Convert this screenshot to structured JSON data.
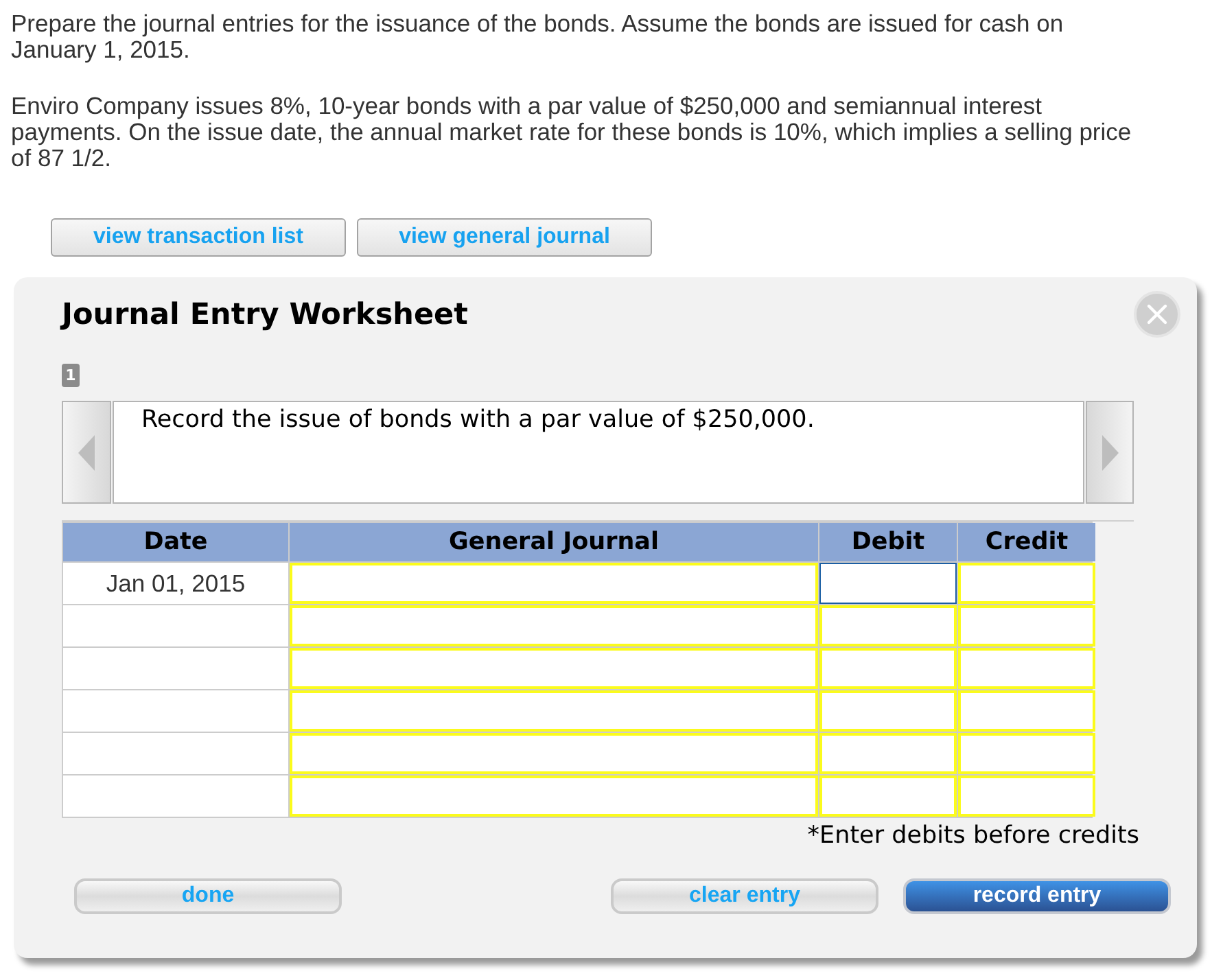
{
  "instructions": [
    "Prepare the journal entries for the issuance of the bonds. Assume the bonds are issued for cash on January 1, 2015.",
    "Enviro Company issues 8%, 10-year bonds with a par value of $250,000 and semiannual interest payments. On the issue date, the annual market rate for these bonds is 10%, which implies a selling price of 87 1/2."
  ],
  "view_buttons": [
    "view transaction list",
    "view general journal"
  ],
  "worksheet": {
    "title": "Journal Entry Worksheet",
    "step": "1",
    "prompt": "Record the issue of bonds with a par value of $250,000.",
    "table": {
      "columns": [
        "Date",
        "General Journal",
        "Debit",
        "Credit"
      ],
      "rows": [
        {
          "date": "Jan 01, 2015",
          "account": {
            "focused": false
          },
          "debit": {
            "focused": true
          },
          "credit": {
            "focused": false
          }
        },
        {
          "account": {
            "focused": false
          },
          "debit": {
            "focused": false
          },
          "credit": {
            "focused": false
          }
        },
        {
          "account": {
            "focused": false
          },
          "debit": {
            "focused": false
          },
          "credit": {
            "focused": false
          }
        },
        {
          "account": {
            "focused": false
          },
          "debit": {
            "focused": false
          },
          "credit": {
            "focused": false
          }
        },
        {
          "account": {
            "focused": false
          },
          "debit": {
            "focused": false
          },
          "credit": {
            "focused": false
          }
        },
        {
          "account": {
            "focused": false
          },
          "debit": {
            "focused": false
          },
          "credit": {
            "focused": false
          }
        }
      ]
    },
    "note": "*Enter debits before credits",
    "footer": {
      "left": [
        {
          "label": "done",
          "kind": "secondary"
        }
      ],
      "right": [
        {
          "label": "clear entry",
          "kind": "secondary"
        },
        {
          "label": "record entry",
          "kind": "primary"
        }
      ]
    }
  }
}
